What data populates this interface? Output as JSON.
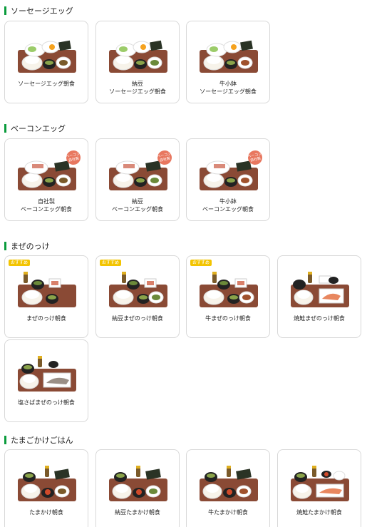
{
  "sections": [
    {
      "title": "ソーセージエッグ",
      "items": [
        {
          "label": "ソーセージエッグ朝食"
        },
        {
          "label": "納豆\nソーセージエッグ朝食"
        },
        {
          "label": "牛小鉢\nソーセージエッグ朝食"
        }
      ]
    },
    {
      "title": "ベーコンエッグ",
      "items": [
        {
          "label": "自社製\nベーコンエッグ朝食",
          "stamp": "ベーコン\n自社製"
        },
        {
          "label": "納豆\nベーコンエッグ朝食",
          "stamp": "ベーコン\n自社製"
        },
        {
          "label": "牛小鉢\nベーコンエッグ朝食",
          "stamp": "ベーコン\n自社製"
        }
      ]
    },
    {
      "title": "まぜのっけ",
      "items": [
        {
          "label": "まぜのっけ朝食",
          "badge": "おすすめ"
        },
        {
          "label": "納豆まぜのっけ朝食",
          "badge": "おすすめ"
        },
        {
          "label": "牛まぜのっけ朝食",
          "badge": "おすすめ"
        },
        {
          "label": "焼鮭まぜのっけ朝食"
        },
        {
          "label": "塩さばまぜのっけ朝食"
        }
      ]
    },
    {
      "title": "たまごかけごはん",
      "items": [
        {
          "label": "たまかけ朝食"
        },
        {
          "label": "納豆たまかけ朝食"
        },
        {
          "label": "牛たまかけ朝食"
        },
        {
          "label": "焼鮭たまかけ朝食"
        }
      ]
    }
  ],
  "colors": {
    "accent_bar": "#0a9b3c",
    "badge": "#f3c400",
    "tray": "#8a4a35",
    "card_border": "#d8d8d8"
  },
  "icons": {
    "tray_photo": "breakfast-set-tray-icon",
    "section_marker": "green-bar-icon"
  }
}
